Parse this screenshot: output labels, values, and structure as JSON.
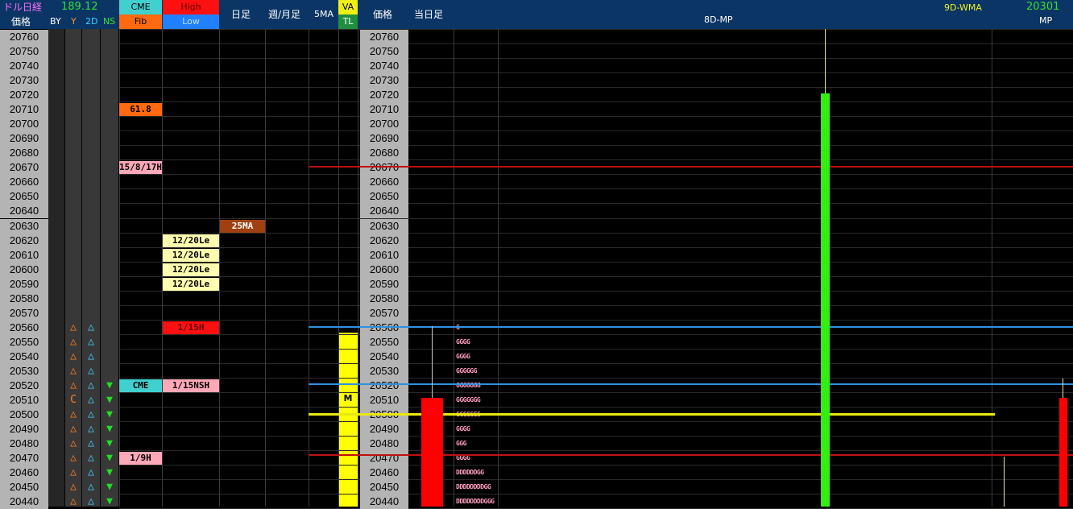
{
  "header": {
    "dollar_nikkei_label": "ドル日経",
    "price_label": "価格",
    "dollar_value": "189.12",
    "by_label": "BY",
    "y_label": "Y",
    "d2_label": "2D",
    "ns_label": "NS",
    "cme_label": "CME",
    "fib_label": "Fib",
    "high_label": "High",
    "low_label": "Low",
    "daily_label": "日足",
    "weekly_monthly_label": "週/月足",
    "ma5_label": "5MA",
    "va_label": "VA",
    "tl_label": "TL",
    "price_label2": "価格",
    "today_label": "当日足",
    "mp8d_label": "8D-MP",
    "wma9d_label": "9D-WMA",
    "mp_value": "20301",
    "mp_label": "MP"
  },
  "prices": [
    "20760",
    "20750",
    "20740",
    "20730",
    "20720",
    "20710",
    "20700",
    "20690",
    "20680",
    "20670",
    "20660",
    "20650",
    "20640",
    "20630",
    "20620",
    "20610",
    "20600",
    "20590",
    "20580",
    "20570",
    "20560",
    "20550",
    "20540",
    "20530",
    "20520",
    "20510",
    "20500",
    "20490",
    "20480",
    "20470",
    "20460",
    "20450",
    "20440"
  ],
  "y_symbols": [
    "",
    "",
    "",
    "",
    "",
    "",
    "",
    "",
    "",
    "",
    "",
    "",
    "",
    "",
    "",
    "",
    "",
    "",
    "",
    "",
    "△",
    "△",
    "△",
    "△",
    "△",
    "C",
    "△",
    "△",
    "△",
    "△",
    "△",
    "△",
    "△"
  ],
  "d2_symbols": [
    "",
    "",
    "",
    "",
    "",
    "",
    "",
    "",
    "",
    "",
    "",
    "",
    "",
    "",
    "",
    "",
    "",
    "",
    "",
    "",
    "△",
    "△",
    "△",
    "△",
    "△",
    "△",
    "△",
    "△",
    "△",
    "△",
    "△",
    "△",
    "△"
  ],
  "ns_symbols": [
    "",
    "",
    "",
    "",
    "",
    "",
    "",
    "",
    "",
    "",
    "",
    "",
    "",
    "",
    "",
    "",
    "",
    "",
    "",
    "",
    "",
    "",
    "",
    "",
    "▼",
    "▼",
    "▼",
    "▼",
    "▼",
    "▼",
    "▼",
    "▼",
    "▼"
  ],
  "cme_fib_labels": [
    {
      "row": 5,
      "text": "61.8",
      "bg": "#ff6a10",
      "fg": "#000000"
    },
    {
      "row": 9,
      "text": "15/8/17H",
      "bg": "#ffa8b8",
      "fg": "#000000"
    },
    {
      "row": 24,
      "text": "CME",
      "bg": "#40d0d0",
      "fg": "#000000"
    },
    {
      "row": 29,
      "text": "1/9H",
      "bg": "#ffa8b8",
      "fg": "#000000"
    }
  ],
  "high_low_labels": [
    {
      "row": 14,
      "text": "12/20Le",
      "bg": "#ffffb0",
      "fg": "#000000"
    },
    {
      "row": 15,
      "text": "12/20Le",
      "bg": "#ffffb0",
      "fg": "#000000"
    },
    {
      "row": 16,
      "text": "12/20Le",
      "bg": "#ffffb0",
      "fg": "#000000"
    },
    {
      "row": 17,
      "text": "12/20Le",
      "bg": "#ffffb0",
      "fg": "#000000"
    },
    {
      "row": 20,
      "text": "1/15H",
      "bg": "#ff1010",
      "fg": "#600000"
    },
    {
      "row": 24,
      "text": "1/15NSH",
      "bg": "#ffa8b8",
      "fg": "#000000"
    }
  ],
  "daily_labels": [
    {
      "row": 13,
      "text": "25MA",
      "bg": "#a04010",
      "fg": "#ffffff"
    }
  ],
  "va_marker": "M",
  "tpo_rows": [
    {
      "row": 20,
      "text": "G"
    },
    {
      "row": 21,
      "text": "GGGG"
    },
    {
      "row": 22,
      "text": "GGGG"
    },
    {
      "row": 23,
      "text": "GGGGGG"
    },
    {
      "row": 24,
      "text": "GGGGGGG"
    },
    {
      "row": 25,
      "text": "GGGGGGG"
    },
    {
      "row": 26,
      "text": "GGGGGGG"
    },
    {
      "row": 27,
      "text": "GGGG"
    },
    {
      "row": 28,
      "text": "GGG"
    },
    {
      "row": 29,
      "text": "GGGG"
    },
    {
      "row": 30,
      "text": "DDDDDDGG"
    },
    {
      "row": 31,
      "text": "DDDDDDDDGG"
    },
    {
      "row": 32,
      "text": "DDDDDDDDGGG"
    }
  ],
  "colors": {
    "header_bg": "#0a3565",
    "price_bg": "#b4b4b4",
    "green_bar": "#33ee11",
    "red_bar": "#ff0000",
    "yellow_line": "#e8e810",
    "red_line": "#d01010",
    "blue_line": "#3090e0"
  }
}
